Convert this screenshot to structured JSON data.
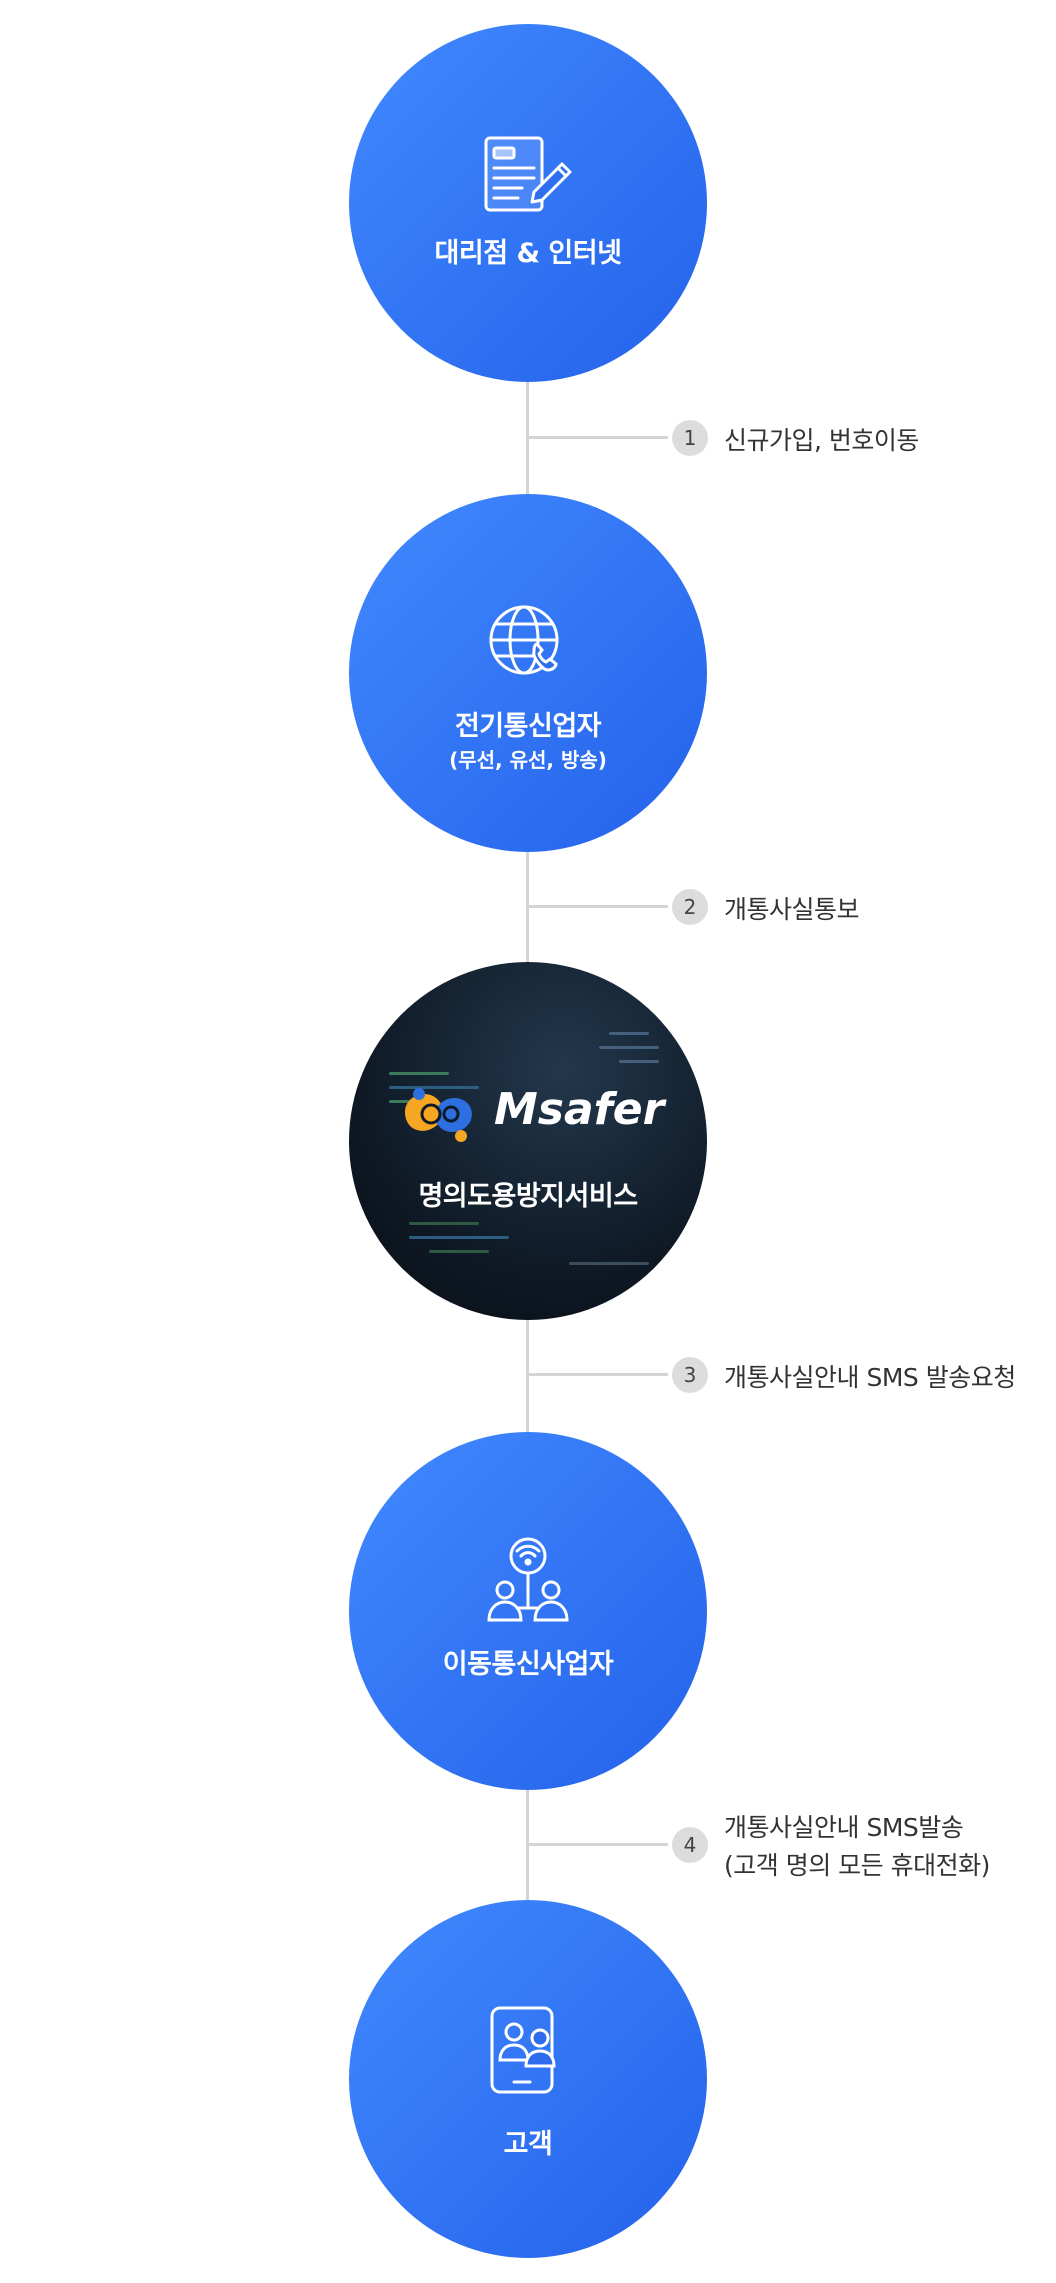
{
  "nodes": [
    {
      "title": "대리점 & 인터넷",
      "icon": "document-pen-icon"
    },
    {
      "title": "전기통신업자",
      "subtitle": "(무선, 유선, 방송)",
      "icon": "globe-phone-icon"
    },
    {
      "title": "명의도용방지서비스",
      "logo": "Msafer",
      "icon": "msafer-logo-icon"
    },
    {
      "title": "이동통신사업자",
      "icon": "network-users-icon"
    },
    {
      "title": "고객",
      "icon": "mobile-users-icon"
    }
  ],
  "steps": [
    {
      "num": "1",
      "label": "신규가입, 번호이동"
    },
    {
      "num": "2",
      "label": "개통사실통보"
    },
    {
      "num": "3",
      "label": "개통사실안내 SMS 발송요청"
    },
    {
      "num": "4",
      "label_line1": "개통사실안내 SMS발송",
      "label_line2": "(고객 명의 모든 휴대전화)"
    }
  ],
  "colors": {
    "circle_start": "#4189ff",
    "circle_end": "#2462ea",
    "connector": "#d4d4d4",
    "logo_orange": "#f5a623",
    "logo_blue": "#2d6fe0"
  }
}
